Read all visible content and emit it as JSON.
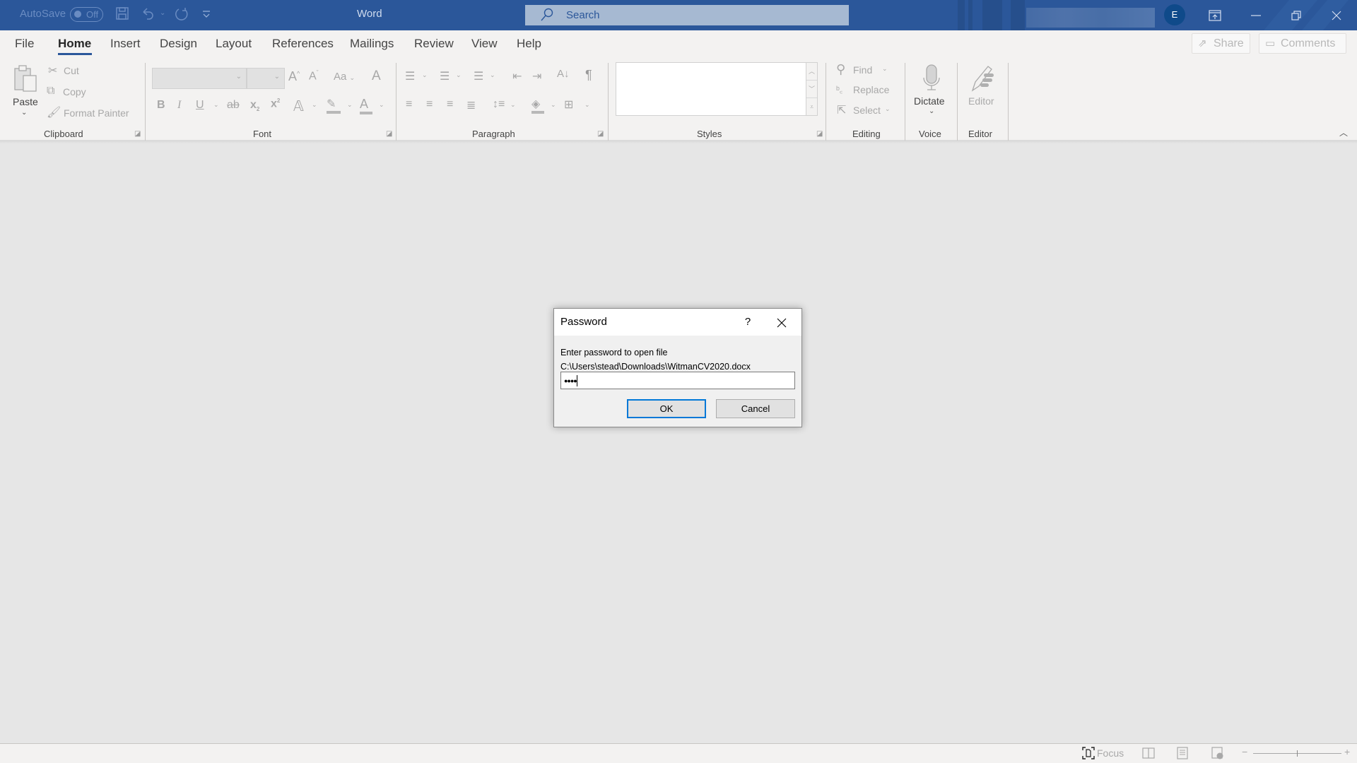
{
  "titlebar": {
    "autosave_label": "AutoSave",
    "autosave_state": "Off",
    "app_title": "Word",
    "search_placeholder": "Search",
    "avatar_initial": "E",
    "colors": {
      "bar": "#2b579a",
      "search_bg": "#a6b9d2"
    }
  },
  "menu": {
    "tabs": [
      {
        "label": "File"
      },
      {
        "label": "Home",
        "active": true
      },
      {
        "label": "Insert"
      },
      {
        "label": "Design"
      },
      {
        "label": "Layout"
      },
      {
        "label": "References"
      },
      {
        "label": "Mailings"
      },
      {
        "label": "Review"
      },
      {
        "label": "View"
      },
      {
        "label": "Help"
      }
    ],
    "share_label": "Share",
    "comments_label": "Comments"
  },
  "ribbon": {
    "clipboard": {
      "label": "Clipboard",
      "paste": "Paste",
      "cut": "Cut",
      "copy": "Copy",
      "format_painter": "Format Painter"
    },
    "font": {
      "label": "Font",
      "font_name": "",
      "font_size": "",
      "change_case": "Aa"
    },
    "paragraph": {
      "label": "Paragraph"
    },
    "styles": {
      "label": "Styles"
    },
    "editing": {
      "label": "Editing",
      "find": "Find",
      "replace": "Replace",
      "select": "Select"
    },
    "voice": {
      "label": "Voice",
      "dictate": "Dictate"
    },
    "editor": {
      "label": "Editor",
      "editor_btn": "Editor"
    }
  },
  "dialog": {
    "title": "Password",
    "help": "?",
    "message": "Enter password to open file",
    "file_path": "C:\\Users\\stead\\Downloads\\WitmanCV2020.docx",
    "password_masked": "●●●●",
    "ok_label": "OK",
    "cancel_label": "Cancel"
  },
  "statusbar": {
    "focus_label": "Focus",
    "zoom_minus": "−",
    "zoom_plus": "+"
  }
}
